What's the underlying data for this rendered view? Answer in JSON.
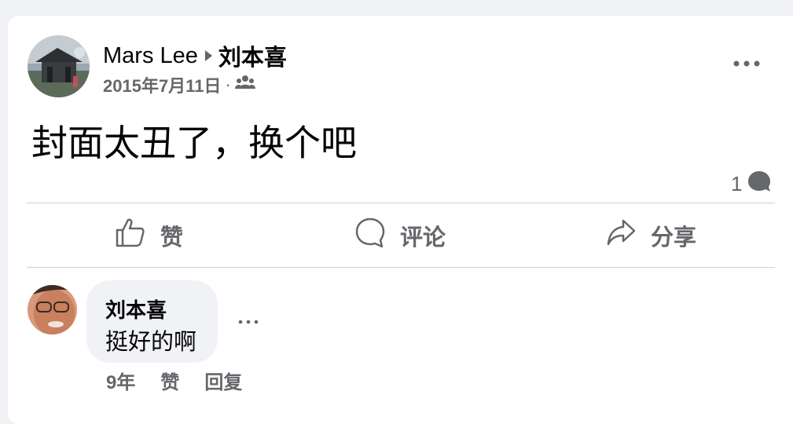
{
  "post": {
    "author": "Mars Lee",
    "target": "刘本喜",
    "date": "2015年7月11日",
    "separator": "·",
    "text": "封面太丑了，换个吧",
    "comment_count": "1",
    "icons": {
      "audience": "friends-icon",
      "more": "more-horizontal-icon",
      "arrow": "caret-right-icon",
      "comment_count": "comment-bubble-icon"
    }
  },
  "actions": {
    "like": "赞",
    "comment": "评论",
    "share": "分享"
  },
  "comment": {
    "author": "刘本喜",
    "text": "挺好的啊",
    "time": "9年",
    "like": "赞",
    "reply": "回复"
  },
  "colors": {
    "background": "#f0f2f5",
    "card": "#ffffff",
    "secondary_text": "#65676b",
    "primary_text": "#050505",
    "divider": "#ced0d4"
  }
}
